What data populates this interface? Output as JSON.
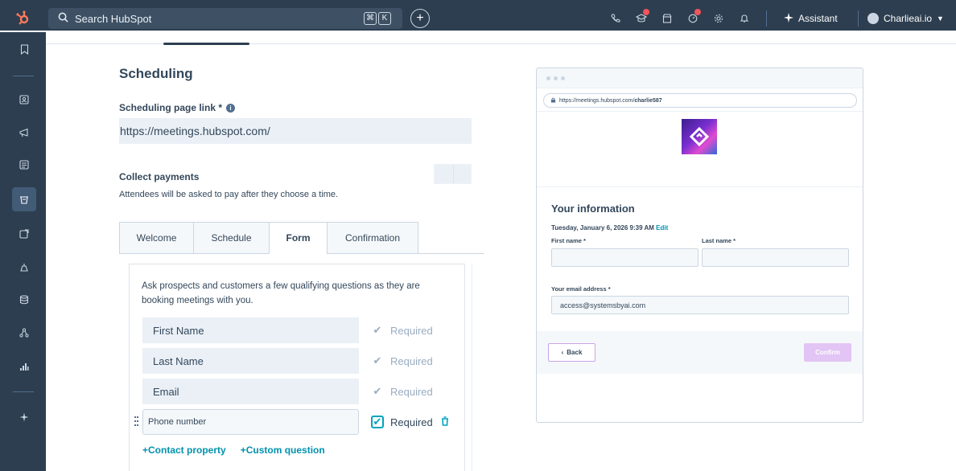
{
  "topbar": {
    "search_placeholder": "Search HubSpot",
    "kbd_1": "⌘",
    "kbd_2": "K",
    "assistant_label": "Assistant",
    "account_name": "Charlieai.io"
  },
  "colors": {
    "nav_bg": "#2d3e50",
    "accent_teal": "#00a4bd",
    "link_blue": "#0091ae",
    "badge_red": "#f2545b"
  },
  "scheduling": {
    "title": "Scheduling",
    "link_label": "Scheduling page link *",
    "link_value": "https://meetings.hubspot.com/",
    "payments_label": "Collect payments",
    "payments_desc": "Attendees will be asked to pay after they choose a time."
  },
  "tabs": [
    {
      "label": "Welcome"
    },
    {
      "label": "Schedule"
    },
    {
      "label": "Form"
    },
    {
      "label": "Confirmation"
    }
  ],
  "form": {
    "description": "Ask prospects and customers a few qualifying questions as they are booking meetings with you.",
    "fields": [
      {
        "label": "First Name",
        "required_label": "Required"
      },
      {
        "label": "Last Name",
        "required_label": "Required"
      },
      {
        "label": "Email",
        "required_label": "Required"
      },
      {
        "label": "Phone number",
        "required_label": "Required"
      }
    ],
    "add_contact_property": "+Contact property",
    "add_custom_question": "+Custom question"
  },
  "preview": {
    "url_prefix": "https://meetings.hubspot.com/",
    "url_user": "charlie587",
    "heading": "Your information",
    "datetime": "Tuesday, January 6, 2026 9:39 AM",
    "edit_label": "Edit",
    "first_name_label": "First name *",
    "last_name_label": "Last name *",
    "email_label": "Your email address *",
    "email_value": "access@systemsbyai.com",
    "back_label": "Back",
    "confirm_label": "Confirm"
  }
}
